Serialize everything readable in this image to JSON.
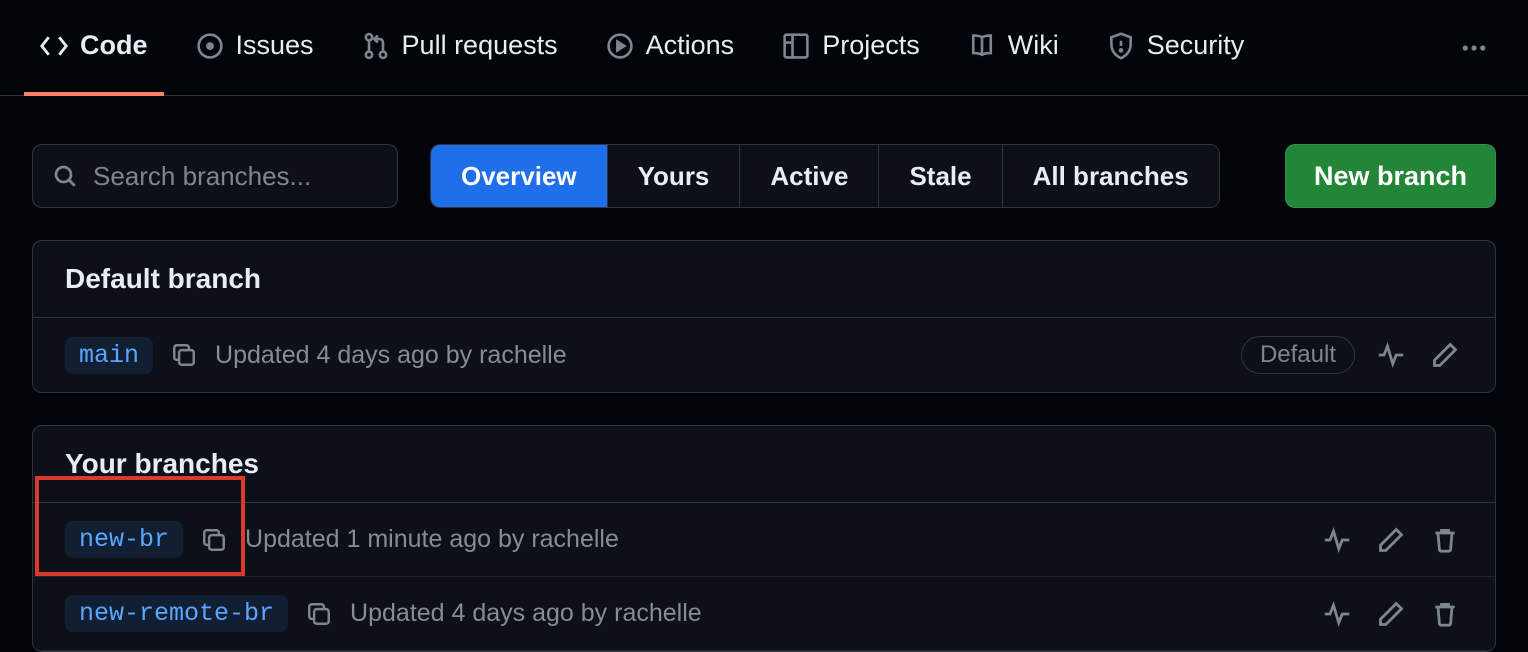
{
  "nav": {
    "items": [
      {
        "label": "Code",
        "icon": "code",
        "selected": true
      },
      {
        "label": "Issues",
        "icon": "issue",
        "selected": false
      },
      {
        "label": "Pull requests",
        "icon": "pr",
        "selected": false
      },
      {
        "label": "Actions",
        "icon": "play",
        "selected": false
      },
      {
        "label": "Projects",
        "icon": "project",
        "selected": false
      },
      {
        "label": "Wiki",
        "icon": "book",
        "selected": false
      },
      {
        "label": "Security",
        "icon": "shield",
        "selected": false
      }
    ]
  },
  "toolbar": {
    "search_placeholder": "Search branches...",
    "filters": [
      "Overview",
      "Yours",
      "Active",
      "Stale",
      "All branches"
    ],
    "selected_filter": "Overview",
    "new_branch_label": "New branch"
  },
  "sections": {
    "default": {
      "title": "Default branch",
      "branch": {
        "name": "main",
        "meta": "Updated 4 days ago by rachelle",
        "badge": "Default"
      }
    },
    "yours": {
      "title": "Your branches",
      "branches": [
        {
          "name": "new-br",
          "meta": "Updated 1 minute ago by rachelle",
          "highlighted": true
        },
        {
          "name": "new-remote-br",
          "meta": "Updated 4 days ago by rachelle",
          "highlighted": false
        }
      ]
    }
  }
}
